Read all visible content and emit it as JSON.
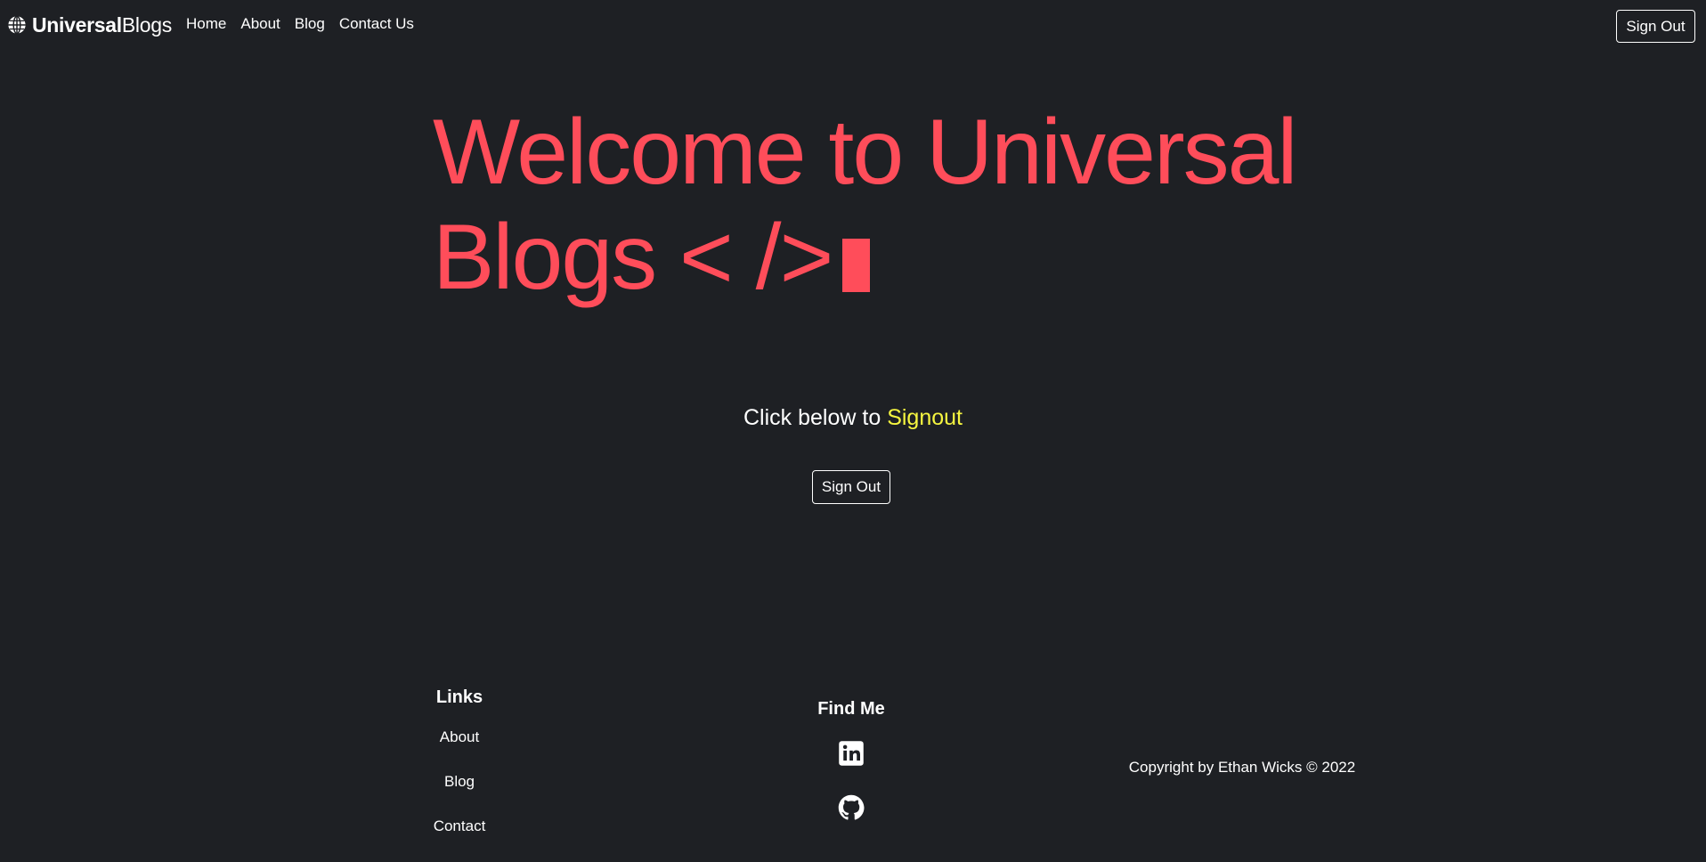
{
  "navbar": {
    "brand_bold": "Universal",
    "brand_light": "Blogs",
    "links": [
      {
        "label": "Home"
      },
      {
        "label": "About"
      },
      {
        "label": "Blog"
      },
      {
        "label": "Contact Us"
      }
    ],
    "signout_label": "Sign Out"
  },
  "hero": {
    "title": "Welcome to Universal Blogs < />",
    "cta_prefix": "Click below to",
    "cta_highlight": "Signout",
    "signout_label": "Sign Out"
  },
  "footer": {
    "links_title": "Links",
    "links": [
      {
        "label": "About"
      },
      {
        "label": "Blog"
      },
      {
        "label": "Contact"
      }
    ],
    "find_me_title": "Find Me",
    "social_icons": [
      "linkedin-icon",
      "github-icon"
    ],
    "copyright": "Copyright by Ethan Wicks © 2022"
  },
  "colors": {
    "background": "#1e2024",
    "accent": "#ff4d5a",
    "highlight": "#f5f540",
    "text": "#ffffff"
  }
}
